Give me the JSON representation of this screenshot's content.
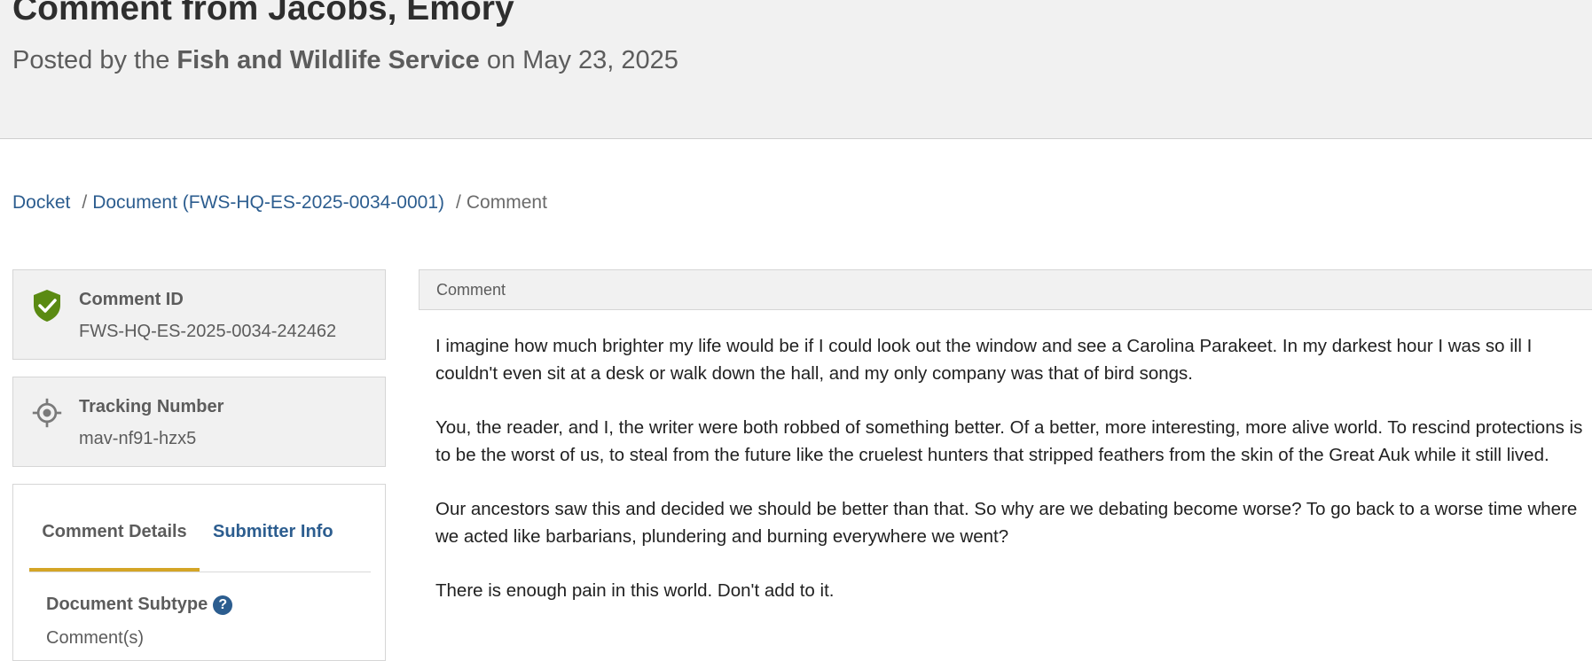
{
  "header": {
    "title": "Comment from Jacobs, Emory",
    "posted_prefix": "Posted by the",
    "agency": "Fish and Wildlife Service",
    "posted_suffix": "on May 23, 2025"
  },
  "breadcrumb": {
    "docket": "Docket",
    "separator": "/",
    "document": "Document (FWS-HQ-ES-2025-0034-0001)",
    "current": "Comment"
  },
  "comment_id": {
    "label": "Comment ID",
    "value": "FWS-HQ-ES-2025-0034-242462",
    "icon": "verified-shield-icon",
    "icon_color": "#5a8a12"
  },
  "tracking": {
    "label": "Tracking Number",
    "value": "mav-nf91-hzx5",
    "icon": "target-icon"
  },
  "details": {
    "tabs": [
      "Comment Details",
      "Submitter Info"
    ],
    "active_tab_color": "#d4a526",
    "subtype_label": "Document Subtype",
    "help_glyph": "?",
    "subtype_value": "Comment(s)"
  },
  "comment": {
    "header": "Comment",
    "paragraphs": [
      "I imagine how much brighter my life would be if I could look out the window and see a Carolina Parakeet. In my darkest hour I was so ill I couldn't even sit at a desk or walk down the hall, and my only company was that of bird songs.",
      "You, the reader, and I, the writer were both robbed of something better. Of a better, more interesting, more alive world. To rescind protections is to be the worst of us, to steal from the future like the cruelest hunters that stripped feathers from the skin of the Great Auk while it still lived.",
      "Our ancestors saw this and decided we should be better than that. So why are we debating become worse? To go back to a worse time where we acted like barbarians, plundering and burning everywhere we went?",
      "There is enough pain in this world. Don't add to it."
    ]
  },
  "colors": {
    "link": "#2c5d8f",
    "header_bg": "#f1f1f1"
  }
}
